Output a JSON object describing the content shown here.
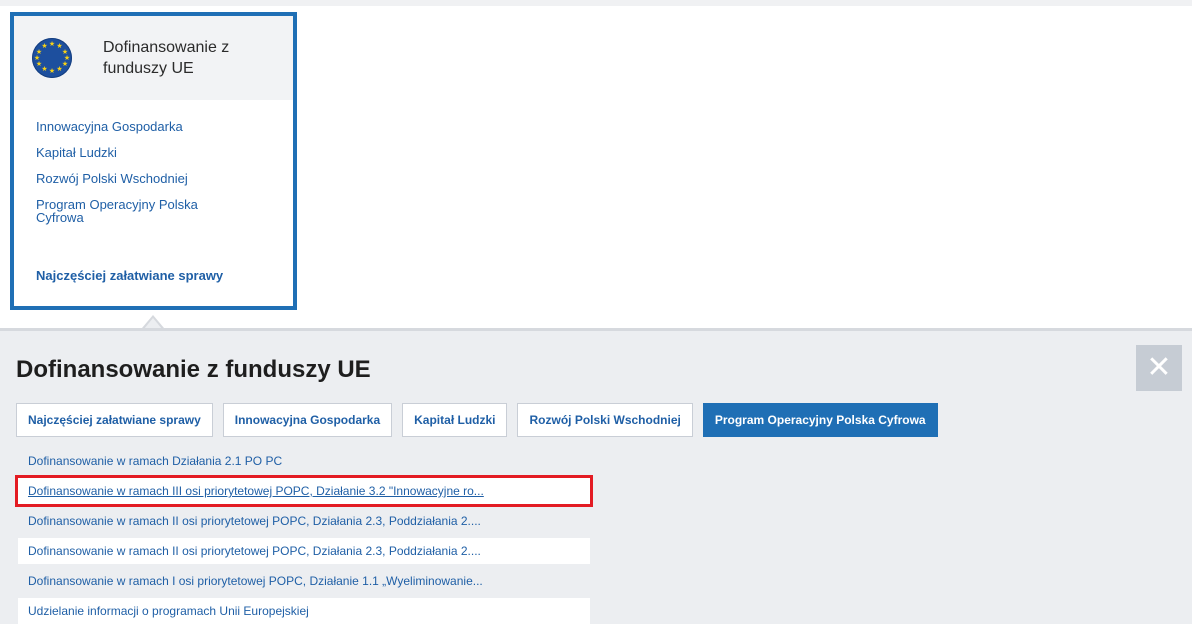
{
  "tile": {
    "icon": "eu-flag-icon",
    "title": "Dofinansowanie z funduszy UE",
    "links": [
      "Innowacyjna Gospodarka",
      "Kapitał Ludzki",
      "Rozwój Polski Wschodniej",
      "Program Operacyjny Polska Cyfrowa"
    ],
    "bold_link": "Najczęściej załatwiane sprawy"
  },
  "panel": {
    "title": "Dofinansowanie z funduszy UE",
    "close_icon": "close-icon",
    "tabs": [
      "Najczęściej załatwiane sprawy",
      "Innowacyjna Gospodarka",
      "Kapitał Ludzki",
      "Rozwój Polski Wschodniej",
      "Program Operacyjny Polska Cyfrowa"
    ],
    "active_tab": "Program Operacyjny Polska Cyfrowa",
    "items": [
      "Dofinansowanie w ramach Działania 2.1 PO PC",
      "Dofinansowanie w ramach III osi priorytetowej POPC, Działanie 3.2 \"Innowacyjne ro...",
      "Dofinansowanie w ramach II osi priorytetowej POPC, Działania 2.3, Poddziałania 2....",
      "Dofinansowanie w ramach II osi priorytetowej POPC, Działania 2.3, Poddziałania 2....",
      "Dofinansowanie w ramach I osi priorytetowej POPC, Działanie 1.1 „Wyeliminowanie...",
      "Udzielanie informacji o programach Unii Europejskiej"
    ]
  },
  "colors": {
    "accent": "#1f6fb5",
    "link": "#1f5fa6",
    "highlight": "#e31b23",
    "panel_bg": "#eceef1"
  }
}
